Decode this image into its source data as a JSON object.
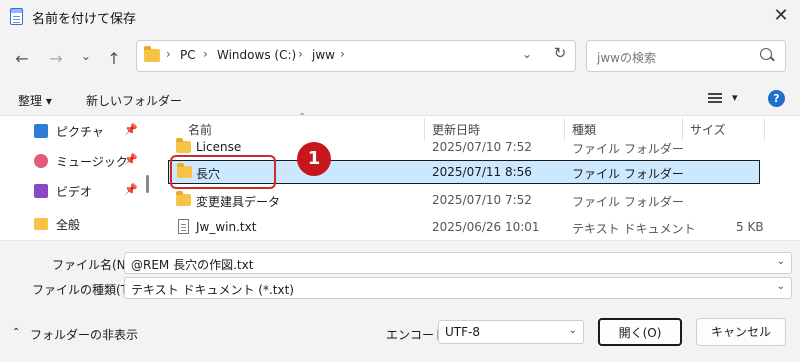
{
  "window": {
    "title": "名前を付けて保存",
    "close_glyph": "✕"
  },
  "nav": {
    "back_glyph": "←",
    "forward_glyph": "→",
    "recent_glyph": "⌄",
    "up_glyph": "↑",
    "breadcrumb": [
      "PC",
      "Windows (C:)",
      "jww"
    ],
    "separator": "›",
    "dropdown_glyph": "⌄",
    "refresh_glyph": "↻",
    "search_placeholder": "jwwの検索"
  },
  "commandbar": {
    "organize": "整理 ▾",
    "new_folder": "新しいフォルダー",
    "view_caret": "▾",
    "help": "?"
  },
  "sidebar": {
    "items": [
      {
        "label": "ピクチャ",
        "pinned": true,
        "icon": "pictures-icon",
        "color": "#2f7bd8"
      },
      {
        "label": "ミュージック",
        "pinned": true,
        "icon": "music-icon",
        "color": "#e35a7d"
      },
      {
        "label": "ビデオ",
        "pinned": true,
        "icon": "video-icon",
        "color": "#8a48c8"
      },
      {
        "label": "全般",
        "pinned": false,
        "icon": "folder-icon",
        "color": "#f5c446"
      }
    ],
    "pin_glyph": "📌"
  },
  "file_list": {
    "headers": {
      "name": "名前",
      "modified": "更新日時",
      "type": "種類",
      "size": "サイズ"
    },
    "sort_glyph": "⌃",
    "rows": [
      {
        "name": "License",
        "modified": "2025/07/10 7:52",
        "type": "ファイル フォルダー",
        "size": "",
        "kind": "folder",
        "selected": false
      },
      {
        "name": "長穴",
        "modified": "2025/07/11 8:56",
        "type": "ファイル フォルダー",
        "size": "",
        "kind": "folder",
        "selected": true
      },
      {
        "name": "変更建具データ",
        "modified": "2025/07/10 7:52",
        "type": "ファイル フォルダー",
        "size": "",
        "kind": "folder",
        "selected": false
      },
      {
        "name": "Jw_win.txt",
        "modified": "2025/06/26 10:01",
        "type": "テキスト ドキュメント",
        "size": "5 KB",
        "kind": "text",
        "selected": false
      }
    ]
  },
  "annotation": {
    "number": "1",
    "color": "#c8161d"
  },
  "form": {
    "filename_label": "ファイル名(N):",
    "filename_value": "@REM 長穴の作図.txt",
    "filetype_label": "ファイルの種類(T):",
    "filetype_value": "テキスト ドキュメント (*.txt)",
    "encoding_label": "エンコード:",
    "encoding_value": "UTF-8",
    "chevron": "⌄"
  },
  "footer": {
    "hide_folders": "フォルダーの非表示",
    "hide_caret": "⌃",
    "open": "開く(O)",
    "cancel": "キャンセル"
  }
}
